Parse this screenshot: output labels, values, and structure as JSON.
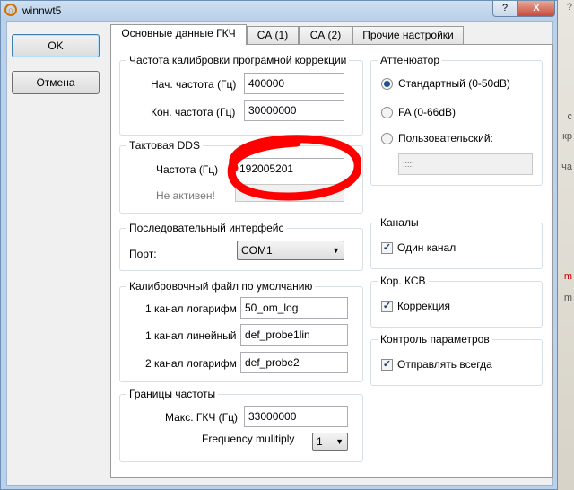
{
  "window": {
    "title": "winnwt5",
    "help_button": "?",
    "close_button": "X"
  },
  "dialog_buttons": {
    "ok": "OK",
    "cancel": "Отмена"
  },
  "tabs": [
    {
      "label": "Основные данные ГКЧ",
      "active": true
    },
    {
      "label": "СА (1)",
      "active": false
    },
    {
      "label": "СА (2)",
      "active": false
    },
    {
      "label": "Прочие настройки",
      "active": false
    }
  ],
  "calibration": {
    "title": "Частота калибровки програмной коррекции",
    "start_label": "Нач. частота (Гц)",
    "start_value": "400000",
    "end_label": "Кон. частота (Гц)",
    "end_value": "30000000"
  },
  "dds": {
    "title": "Тактовая DDS",
    "freq_label": "Частота (Гц)",
    "freq_value": "192005201",
    "inactive_label": "Не  активен!"
  },
  "serial": {
    "title": "Последовательный интерфейс",
    "port_label": "Порт:",
    "port_value": "COM1"
  },
  "calib_file": {
    "title": "Калибровочный файл по умолчанию",
    "ch1_log_label": "1 канал логарифм",
    "ch1_log_value": "50_om_log",
    "ch1_lin_label": "1 канал линейный",
    "ch1_lin_value": "def_probe1lin",
    "ch2_log_label": "2 канал логарифм",
    "ch2_log_value": "def_probe2"
  },
  "freq_limits": {
    "title": "Границы частоты",
    "max_label": "Макс. ГКЧ (Гц)",
    "max_value": "33000000",
    "mult_label": "Frequency mulitiply",
    "mult_value": "1"
  },
  "attenuator": {
    "title": "Аттенюатор",
    "options": [
      {
        "label": "Стандартный (0-50dB)",
        "selected": true
      },
      {
        "label": "FA (0-66dB)",
        "selected": false
      },
      {
        "label": "Пользовательский:",
        "selected": false
      }
    ],
    "custom_value": ":::::"
  },
  "channels": {
    "title": "Каналы",
    "one_channel_label": "Один канал",
    "one_channel_checked": true
  },
  "vswr": {
    "title": "Кор. КСВ",
    "correction_label": "Коррекция",
    "correction_checked": true
  },
  "params": {
    "title": "Контроль параметров",
    "send_always_label": "Отправлять всегда",
    "send_always_checked": true
  },
  "annotation_color": "#ff0000",
  "background_marks": [
    "?",
    "с",
    "кр",
    "ча",
    "m",
    "m"
  ]
}
